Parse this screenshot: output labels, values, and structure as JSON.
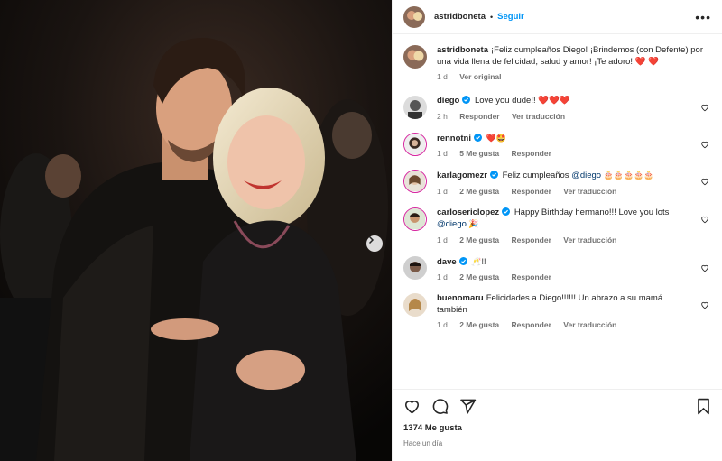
{
  "post": {
    "author": "astridboneta",
    "follow_label": "Seguir",
    "dot": "•",
    "more_label": "•••",
    "caption": {
      "user": "astridboneta",
      "text": "¡Feliz cumpleaños Diego! ¡Brindemos (con Defente) por una vida llena de felicidad, salud y amor! ¡Te adoro! ❤️ ❤️",
      "time": "1 d",
      "see_original": "Ver original"
    }
  },
  "comments": [
    {
      "user": "diego",
      "verified": true,
      "text": "Love you dude!! ❤️❤️❤️",
      "time": "2 h",
      "likes": "",
      "reply": "Responder",
      "translate": "Ver traducción"
    },
    {
      "user": "rennotni",
      "verified": true,
      "text": "❤️🤩",
      "time": "1 d",
      "likes": "5 Me gusta",
      "reply": "Responder",
      "translate": ""
    },
    {
      "user": "karlagomezr",
      "verified": true,
      "text_before": "Feliz cumpleaños ",
      "mention": "@diego",
      "text_after": " 🎂🎂🎂🎂🎂",
      "time": "1 d",
      "likes": "2 Me gusta",
      "reply": "Responder",
      "translate": "Ver traducción"
    },
    {
      "user": "carlosericlopez",
      "verified": true,
      "text_before": "Happy Birthday hermano!!! Love you lots ",
      "mention": "@diego",
      "text_after": " 🎉",
      "time": "1 d",
      "likes": "2 Me gusta",
      "reply": "Responder",
      "translate": "Ver traducción"
    },
    {
      "user": "dave",
      "verified": true,
      "text": "🥂!!",
      "time": "1 d",
      "likes": "2 Me gusta",
      "reply": "Responder",
      "translate": ""
    },
    {
      "user": "buenomaru",
      "verified": false,
      "text": "Felicidades a Diego!!!!!! Un abrazo a su mamá también",
      "time": "1 d",
      "likes": "2 Me gusta",
      "reply": "Responder",
      "translate": "Ver traducción"
    }
  ],
  "footer": {
    "likes": "1374 Me gusta",
    "time_ago": "Hace un día"
  },
  "icons": {
    "like": "heart-icon",
    "comment": "comment-icon",
    "share": "share-icon",
    "save": "bookmark-icon",
    "next": "chevron-right-icon"
  },
  "colors": {
    "accent": "#0095f6",
    "heart": "#ed4956",
    "verified": "#0095f6",
    "muted": "#737373",
    "text": "#262626"
  }
}
